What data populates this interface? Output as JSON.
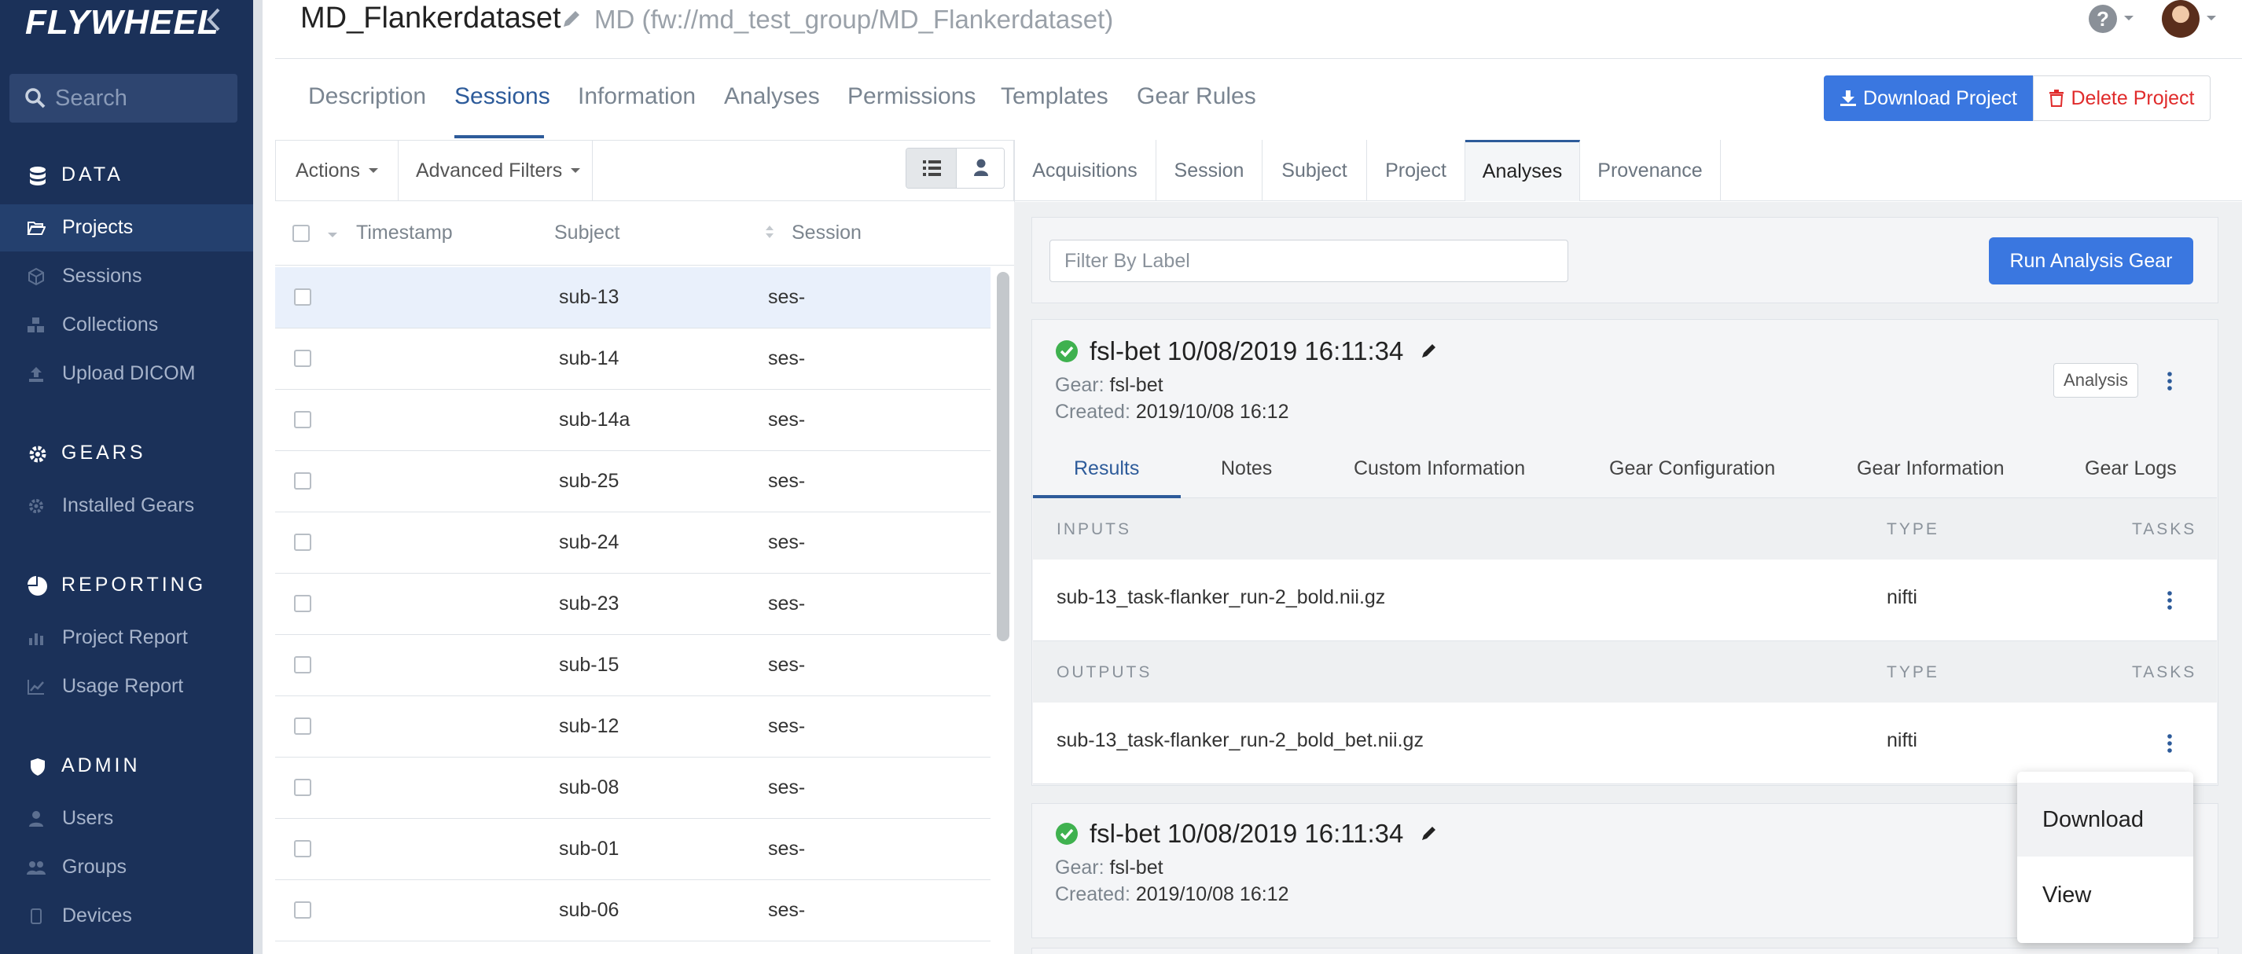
{
  "app": {
    "logo": "FLYWHEEL"
  },
  "sidebar": {
    "search_placeholder": "Search",
    "sections": {
      "data": "DATA",
      "gears": "GEARS",
      "reporting": "REPORTING",
      "admin": "ADMIN"
    },
    "items": {
      "projects": "Projects",
      "sessions": "Sessions",
      "collections": "Collections",
      "upload_dicom": "Upload DICOM",
      "installed_gears": "Installed Gears",
      "project_report": "Project Report",
      "usage_report": "Usage Report",
      "users": "Users",
      "groups": "Groups",
      "devices": "Devices"
    },
    "active_item": "Projects"
  },
  "header": {
    "title": "MD_Flankerdataset",
    "subtitle": "MD (fw://md_test_group/MD_Flankerdataset)"
  },
  "tabs": {
    "description": "Description",
    "sessions": "Sessions",
    "information": "Information",
    "analyses": "Analyses",
    "permissions": "Permissions",
    "templates": "Templates",
    "gear_rules": "Gear Rules",
    "active": "Sessions"
  },
  "buttons": {
    "download_project": "Download Project",
    "delete_project": "Delete Project",
    "run_analysis_gear": "Run Analysis Gear"
  },
  "colors": {
    "sidebar_bg": "#1b3159",
    "accent": "#3a77e0",
    "danger": "#e02b2b",
    "success": "#3fb14f",
    "link": "#2d5b9a"
  },
  "list": {
    "toolbar": {
      "actions": "Actions",
      "advanced_filters": "Advanced Filters"
    },
    "columns": {
      "timestamp": "Timestamp",
      "subject": "Subject",
      "session": "Session"
    },
    "rows": [
      {
        "subject": "sub-13",
        "session": "ses-"
      },
      {
        "subject": "sub-14",
        "session": "ses-"
      },
      {
        "subject": "sub-14a",
        "session": "ses-"
      },
      {
        "subject": "sub-25",
        "session": "ses-"
      },
      {
        "subject": "sub-24",
        "session": "ses-"
      },
      {
        "subject": "sub-23",
        "session": "ses-"
      },
      {
        "subject": "sub-15",
        "session": "ses-"
      },
      {
        "subject": "sub-12",
        "session": "ses-"
      },
      {
        "subject": "sub-08",
        "session": "ses-"
      },
      {
        "subject": "sub-01",
        "session": "ses-"
      },
      {
        "subject": "sub-06",
        "session": "ses-"
      }
    ]
  },
  "right_tabs": {
    "acquisitions": "Acquisitions",
    "session": "Session",
    "subject": "Subject",
    "project": "Project",
    "analyses": "Analyses",
    "provenance": "Provenance",
    "active": "Analyses"
  },
  "filter": {
    "placeholder": "Filter By Label"
  },
  "analyses": [
    {
      "title": "fsl-bet 10/08/2019 16:11:34",
      "gear_label": "Gear:",
      "gear": "fsl-bet",
      "created_label": "Created:",
      "created": "2019/10/08 16:12",
      "badge": "Analysis",
      "tabs": {
        "results": "Results",
        "notes": "Notes",
        "custom_information": "Custom Information",
        "gear_configuration": "Gear Configuration",
        "gear_information": "Gear Information",
        "gear_logs": "Gear Logs"
      },
      "inputs_label": "INPUTS",
      "outputs_label": "OUTPUTS",
      "type_label": "TYPE",
      "tasks_label": "TASKS",
      "inputs": [
        {
          "name": "sub-13_task-flanker_run-2_bold.nii.gz",
          "type": "nifti"
        }
      ],
      "outputs": [
        {
          "name": "sub-13_task-flanker_run-2_bold_bet.nii.gz",
          "type": "nifti"
        }
      ]
    },
    {
      "title": "fsl-bet 10/08/2019 16:11:34",
      "gear_label": "Gear:",
      "gear": "fsl-bet",
      "created_label": "Created:",
      "created": "2019/10/08 16:12"
    }
  ],
  "dropdown": {
    "download": "Download",
    "view": "View"
  }
}
